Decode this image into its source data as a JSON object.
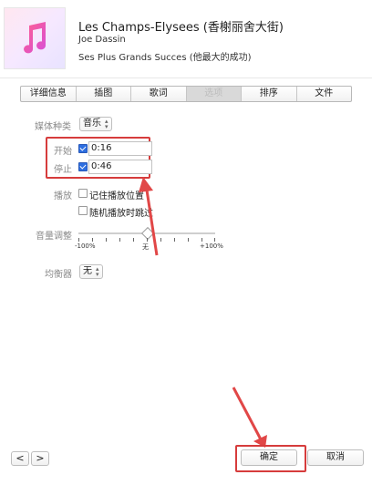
{
  "track": {
    "title": "Les Champs-Elysees (香榭丽舍大街)",
    "artist": "Joe Dassin",
    "album": "Ses Plus Grands Succes (他最大的成功)"
  },
  "tabs": [
    {
      "label": "详细信息",
      "active": false
    },
    {
      "label": "插图",
      "active": false
    },
    {
      "label": "歌词",
      "active": false
    },
    {
      "label": "选项",
      "active": true
    },
    {
      "label": "排序",
      "active": false
    },
    {
      "label": "文件",
      "active": false
    }
  ],
  "options": {
    "media_kind": {
      "label": "媒体种类",
      "value": "音乐"
    },
    "start": {
      "label": "开始",
      "checked": true,
      "value": "0:16"
    },
    "stop": {
      "label": "停止",
      "checked": true,
      "value": "0:46"
    },
    "playback": {
      "label": "播放",
      "remember_position": {
        "label": "记住播放位置",
        "checked": false
      },
      "skip_shuffle": {
        "label": "随机播放时跳过",
        "checked": false
      }
    },
    "volume": {
      "label": "音量调整",
      "min_label": "-100%",
      "mid_label": "无",
      "max_label": "+100%",
      "percent": 0
    },
    "equalizer": {
      "label": "均衡器",
      "value": "无"
    }
  },
  "footer": {
    "prev": "<",
    "next": ">",
    "ok": "确定",
    "cancel": "取消"
  },
  "colors": {
    "annotation": "#d63c3c",
    "checkbox_checked": "#2d6ee0"
  }
}
